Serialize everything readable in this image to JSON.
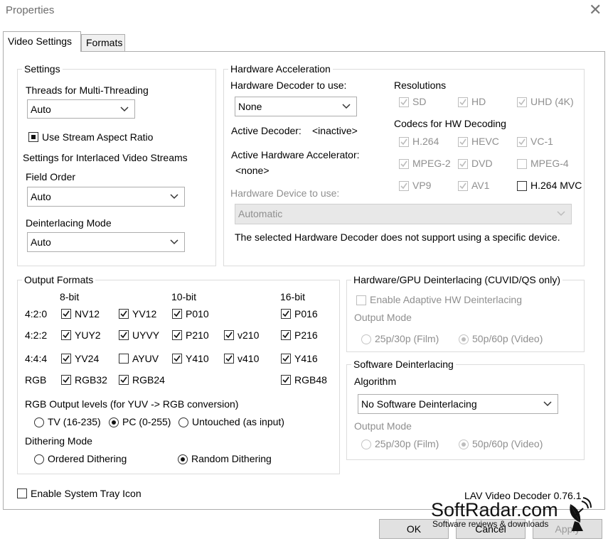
{
  "window": {
    "title": "Properties",
    "close_glyph": "✕"
  },
  "tabs": [
    {
      "label": "Video Settings"
    },
    {
      "label": "Formats"
    }
  ],
  "settings": {
    "title": "Settings",
    "threads_label": "Threads for Multi-Threading",
    "threads_value": "Auto",
    "stream_aspect_label": "Use Stream Aspect Ratio",
    "interlaced_label": "Settings for Interlaced Video Streams",
    "field_order_label": "Field Order",
    "field_order_value": "Auto",
    "deint_mode_label": "Deinterlacing Mode",
    "deint_mode_value": "Auto"
  },
  "hwaccel": {
    "title": "Hardware Acceleration",
    "decoder_label": "Hardware Decoder to use:",
    "decoder_value": "None",
    "active_decoder_label": "Active Decoder:",
    "active_decoder_value": "<inactive>",
    "active_accel_label": "Active Hardware Accelerator:",
    "active_accel_value": "<none>",
    "device_label": "Hardware Device to use:",
    "device_value": "Automatic",
    "note": "The selected Hardware Decoder does not support using a specific device.",
    "resolutions_label": "Resolutions",
    "resolutions": [
      "SD",
      "HD",
      "UHD (4K)"
    ],
    "codecs_label": "Codecs for HW Decoding",
    "codecs": [
      "H.264",
      "HEVC",
      "VC-1",
      "MPEG-2",
      "DVD",
      "MPEG-4",
      "VP9",
      "AV1",
      "H.264 MVC"
    ]
  },
  "output": {
    "title": "Output Formats",
    "col_8bit": "8-bit",
    "col_10bit": "10-bit",
    "col_16bit": "16-bit",
    "rows": [
      "4:2:0",
      "4:2:2",
      "4:4:4",
      "RGB"
    ],
    "formats": {
      "nv12": "NV12",
      "yv12": "YV12",
      "p010": "P010",
      "p016": "P016",
      "yuy2": "YUY2",
      "uyvy": "UYVY",
      "p210": "P210",
      "v210": "v210",
      "p216": "P216",
      "yv24": "YV24",
      "ayuv": "AYUV",
      "y410": "Y410",
      "v410": "v410",
      "y416": "Y416",
      "rgb32": "RGB32",
      "rgb24": "RGB24",
      "rgb48": "RGB48"
    },
    "levels_label": "RGB Output levels (for YUV -> RGB conversion)",
    "levels": [
      "TV (16-235)",
      "PC (0-255)",
      "Untouched (as input)"
    ],
    "dither_label": "Dithering Mode",
    "dither": [
      "Ordered Dithering",
      "Random Dithering"
    ]
  },
  "gpu_deint": {
    "title": "Hardware/GPU Deinterlacing (CUVID/QS only)",
    "adaptive_label": "Enable Adaptive HW Deinterlacing",
    "output_mode_label": "Output Mode",
    "mode_film": "25p/30p (Film)",
    "mode_video": "50p/60p (Video)"
  },
  "sw_deint": {
    "title": "Software Deinterlacing",
    "algorithm_label": "Algorithm",
    "algorithm_value": "No Software Deinterlacing",
    "output_mode_label": "Output Mode",
    "mode_film": "25p/30p (Film)",
    "mode_video": "50p/60p (Video)"
  },
  "footer": {
    "tray_label": "Enable System Tray Icon",
    "version": "LAV Video Decoder 0.76.1",
    "ok": "OK",
    "cancel": "Cancel",
    "apply": "Apply"
  },
  "watermark": {
    "brand": "SoftRadar.com",
    "tagline": "Software reviews & downloads"
  },
  "icons": [
    "close-icon",
    "chevron-down-icon",
    "checkmark-icon",
    "satellite-dish-icon"
  ]
}
